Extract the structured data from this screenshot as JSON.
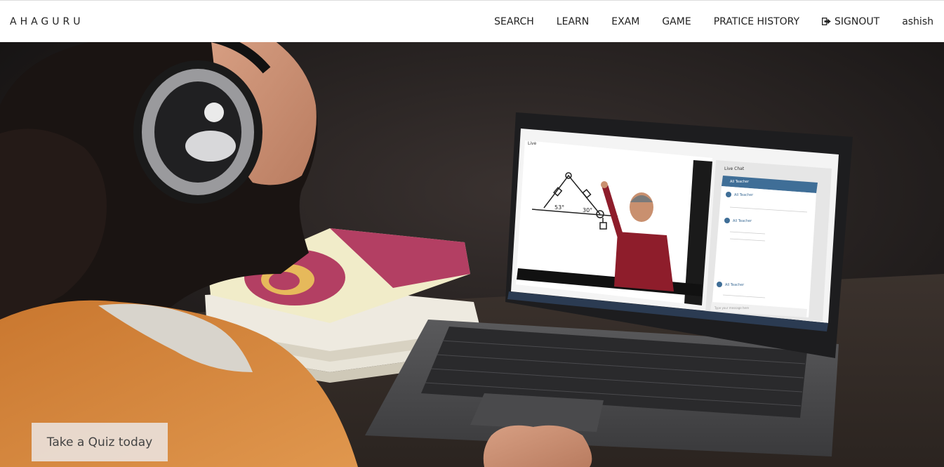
{
  "header": {
    "brand": "AHAGURU",
    "nav": {
      "search": "SEARCH",
      "learn": "LEARN",
      "exam": "EXAM",
      "game": "GAME",
      "practice_history": "PRATICE HISTORY",
      "signout": "SIGNOUT",
      "user": "ashish"
    }
  },
  "hero": {
    "cta_label": "Take a Quiz today",
    "image_description_icon": "student-laptop-photo",
    "screen": {
      "live_label": "Live",
      "chat_title": "Live Chat",
      "chat_header": "All Teacher",
      "chat_messages": [
        "All Teacher",
        "All Teacher",
        "All Teacher"
      ],
      "chat_input_placeholder": "Type your message here",
      "angle_labels": [
        "53°",
        "30°"
      ]
    }
  },
  "colors": {
    "navbar_bg": "#ffffff",
    "nav_text": "#222222",
    "cta_bg": "#ebe4e0",
    "chat_header": "#3f6e97"
  }
}
